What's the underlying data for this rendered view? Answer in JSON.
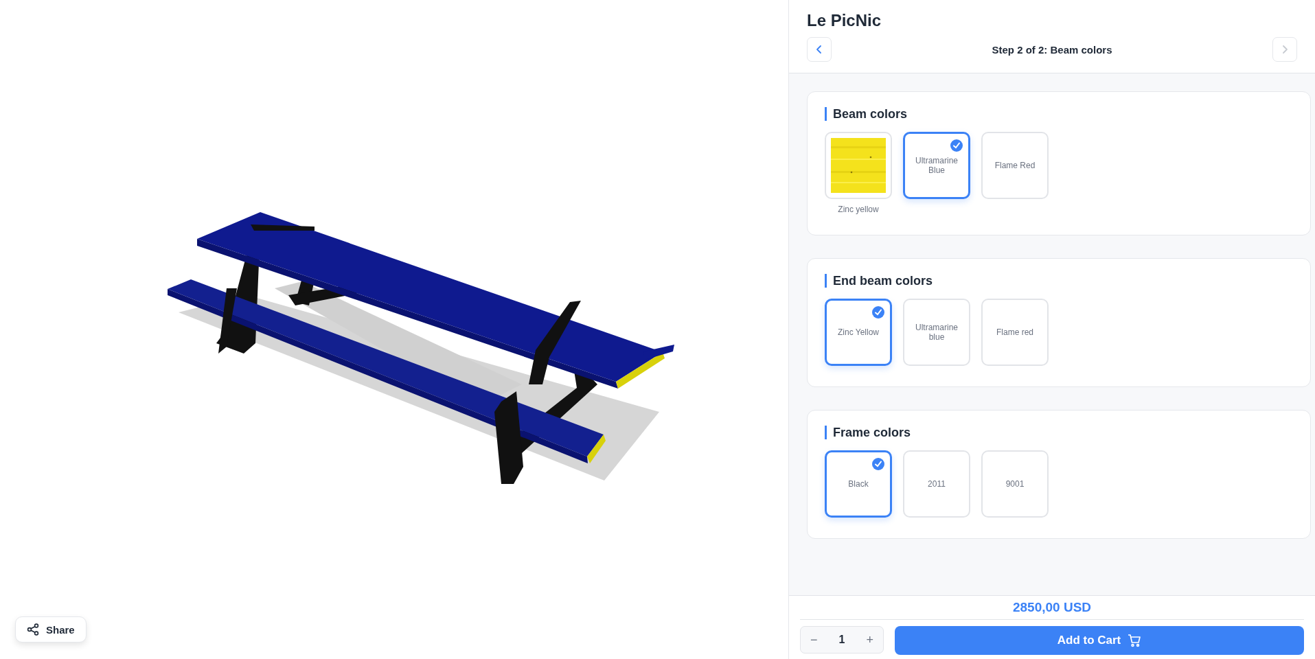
{
  "product": {
    "title": "Le PicNic"
  },
  "stepper": {
    "label": "Step 2 of 2: Beam colors",
    "prev_disabled": false,
    "next_disabled": true
  },
  "sections": [
    {
      "title": "Beam colors",
      "options": [
        {
          "label": "Zinc yellow",
          "selected": false
        },
        {
          "label": "Ultramarine Blue",
          "kind": "text",
          "selected": true
        },
        {
          "label": "Flame Red",
          "kind": "text",
          "selected": false
        }
      ]
    },
    {
      "title": "End beam colors",
      "options": [
        {
          "label": "Zinc Yellow",
          "kind": "text",
          "selected": true
        },
        {
          "label": "Ultramarine blue",
          "kind": "text",
          "selected": false
        },
        {
          "label": "Flame red",
          "kind": "text",
          "selected": false
        }
      ]
    },
    {
      "title": "Frame colors",
      "options": [
        {
          "label": "Black",
          "kind": "text",
          "selected": true
        },
        {
          "label": "2011",
          "kind": "text",
          "selected": false
        },
        {
          "label": "9001",
          "kind": "text",
          "selected": false
        }
      ]
    }
  ],
  "price": "2850,00 USD",
  "quantity": {
    "minus": "−",
    "value": "1",
    "plus": "+"
  },
  "add_to_cart": "Add to Cart",
  "share": "Share"
}
